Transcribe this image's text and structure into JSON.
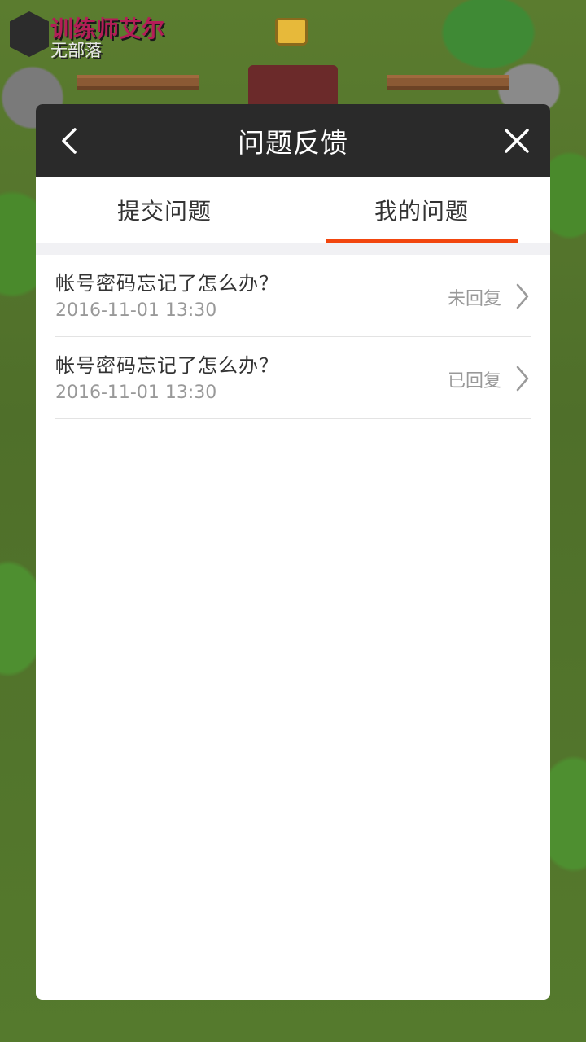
{
  "player": {
    "name": "训练师艾尔",
    "clan": "无部落"
  },
  "dialog": {
    "title": "问题反馈",
    "back_icon": "chevron-left-icon",
    "close_icon": "close-icon"
  },
  "tabs": [
    {
      "label": "提交问题",
      "active": false
    },
    {
      "label": "我的问题",
      "active": true
    }
  ],
  "questions": [
    {
      "title": "帐号密码忘记了怎么办？",
      "time": "2016-11-01 13:30",
      "status": "未回复"
    },
    {
      "title": "帐号密码忘记了怎么办？",
      "time": "2016-11-01 13:30",
      "status": "已回复"
    }
  ],
  "colors": {
    "accent": "#f2460e",
    "header_bg": "#0c0c0c",
    "text_primary": "#333333",
    "text_secondary": "#999999"
  }
}
